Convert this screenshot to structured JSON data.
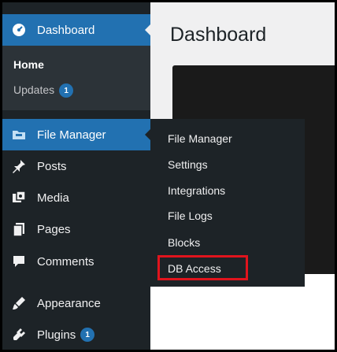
{
  "sidebar": {
    "dashboard": {
      "label": "Dashboard",
      "icon": "dashboard-icon"
    },
    "submenu": {
      "home": "Home",
      "updates": "Updates",
      "updates_count": "1"
    },
    "file_manager": {
      "label": "File Manager",
      "icon": "folder-icon"
    },
    "posts": {
      "label": "Posts",
      "icon": "pin-icon"
    },
    "media": {
      "label": "Media",
      "icon": "media-icon"
    },
    "pages": {
      "label": "Pages",
      "icon": "pages-icon"
    },
    "comments": {
      "label": "Comments",
      "icon": "comment-icon"
    },
    "appearance": {
      "label": "Appearance",
      "icon": "brush-icon"
    },
    "plugins": {
      "label": "Plugins",
      "icon": "plugin-icon",
      "count": "1"
    }
  },
  "main": {
    "title": "Dashboard"
  },
  "flyout": {
    "items": [
      "File Manager",
      "Settings",
      "Integrations",
      "File Logs",
      "Blocks",
      "DB Access"
    ],
    "highlighted": "DB Access"
  },
  "colors": {
    "sidebar_bg": "#1d2327",
    "active_bg": "#2271b1",
    "highlight": "#e0141d"
  }
}
